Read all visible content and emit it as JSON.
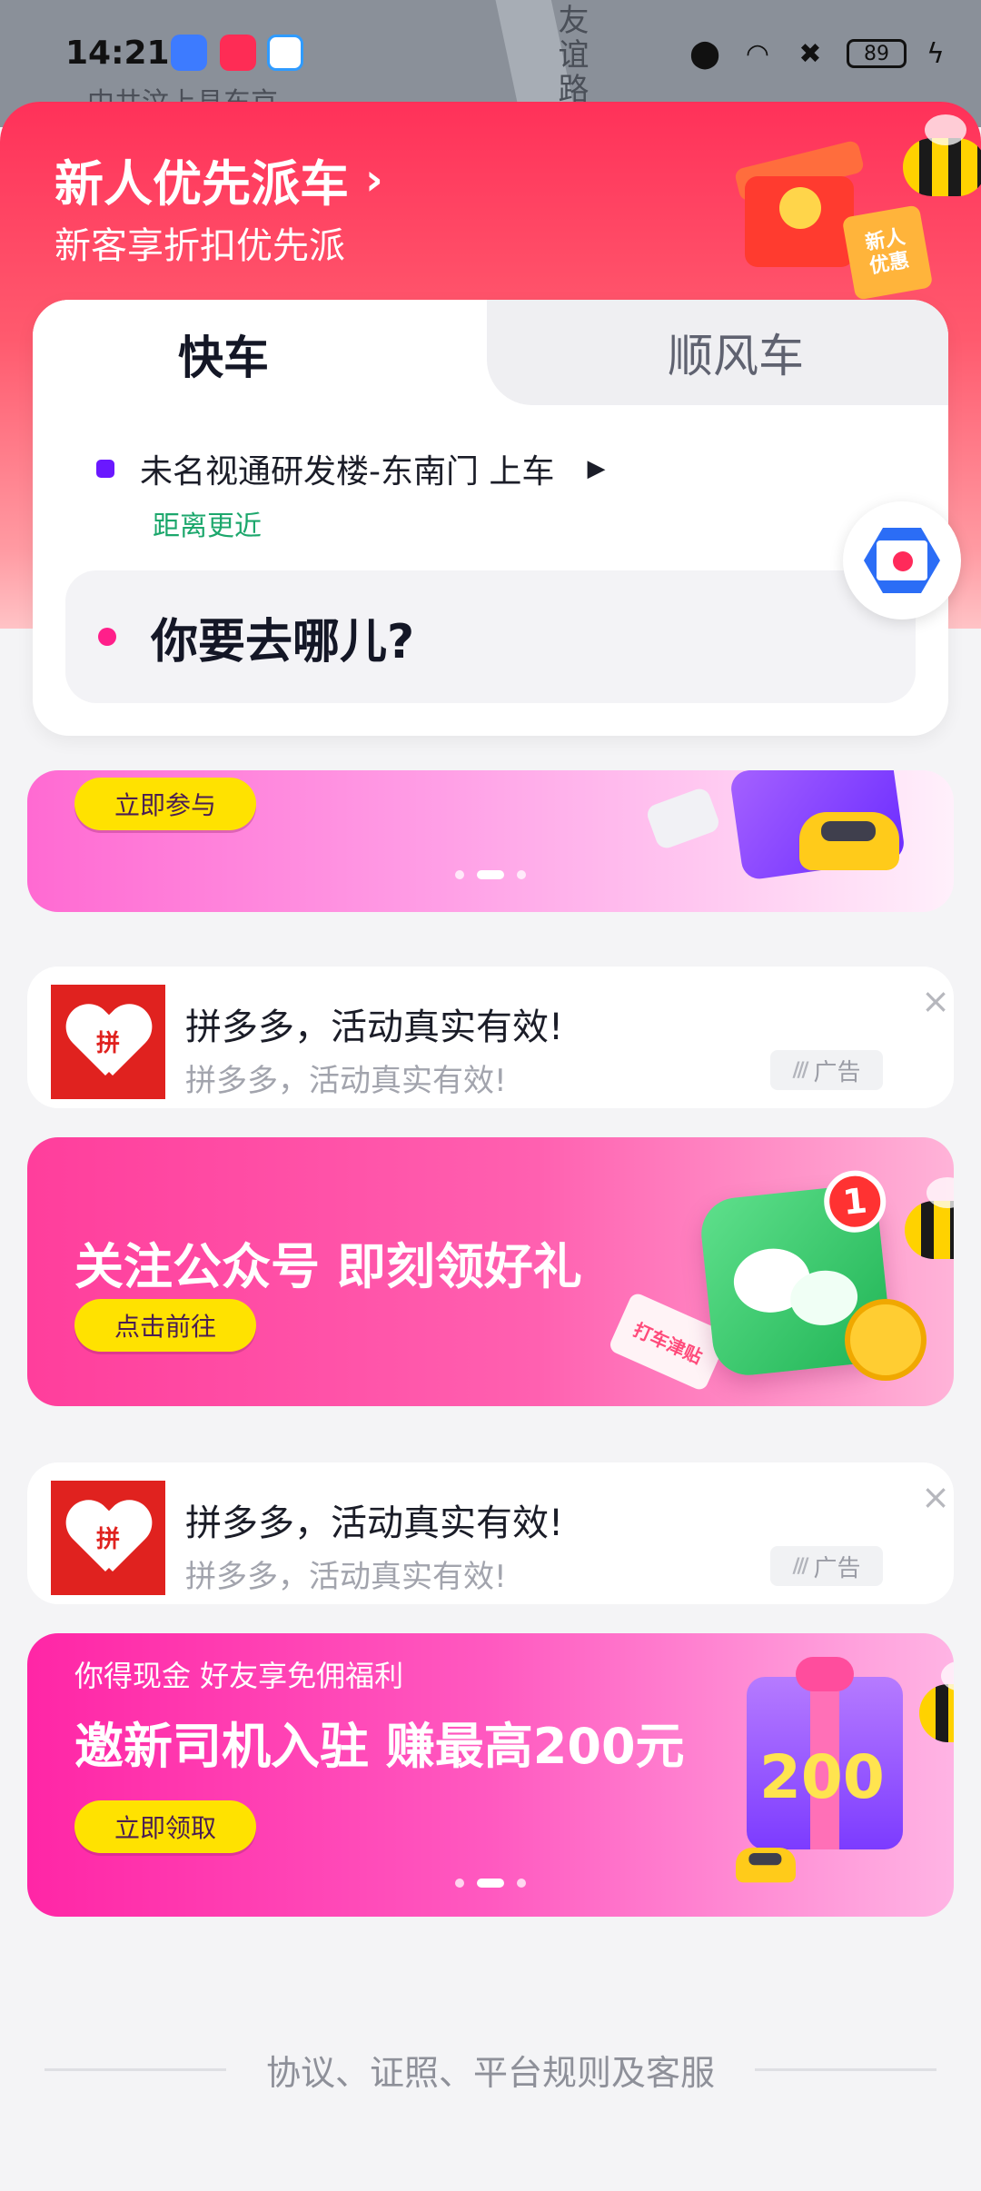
{
  "status_bar": {
    "time": "14:21",
    "battery": "89",
    "icons": [
      "shield-app-icon",
      "music-app-icon",
      "browser-app-icon",
      "location-icon",
      "wifi-icon",
      "sim-off-icon",
      "battery-icon",
      "charging-icon"
    ]
  },
  "map": {
    "road_label": "友谊路",
    "hint": "中共汶上县东京"
  },
  "hero": {
    "title": "新人优先派车",
    "chevron": "›",
    "subtitle": "新客享折扣优先派",
    "tag_line1": "新人",
    "tag_line2": "优惠"
  },
  "booking": {
    "tabs": [
      {
        "label": "快车",
        "active": true
      },
      {
        "label": "顺风车",
        "active": false
      }
    ],
    "pickup": {
      "text": "未名视通研发楼-东南门 上车",
      "arrow": "▶",
      "hint": "距离更近"
    },
    "destination_placeholder": "你要去哪儿?"
  },
  "banners": {
    "b1": {
      "cta": "立即参与"
    },
    "b2": {
      "title": "关注公众号 即刻领好礼",
      "cta": "点击前往",
      "badge": "1",
      "ticket": "打车津贴"
    },
    "b3": {
      "kicker": "你得现金 好友享免佣福利",
      "title": "邀新司机入驻 赚最高200元",
      "cta": "立即领取",
      "gift_num": "200"
    }
  },
  "ads": [
    {
      "logo_text": "拼",
      "title": "拼多多，活动真实有效!",
      "subtitle": "拼多多，活动真实有效!",
      "tag": "广告",
      "close": "×"
    },
    {
      "logo_text": "拼",
      "title": "拼多多，活动真实有效!",
      "subtitle": "拼多多，活动真实有效!",
      "tag": "广告",
      "close": "×"
    }
  ],
  "footer": {
    "text": "协议、证照、平台规则及客服"
  },
  "colors": {
    "accent_red": "#ff3159",
    "accent_purple": "#6a18ff",
    "accent_pink": "#ff1f8a",
    "hint_green": "#1ca76c",
    "cta_yellow": "#ffe200"
  }
}
